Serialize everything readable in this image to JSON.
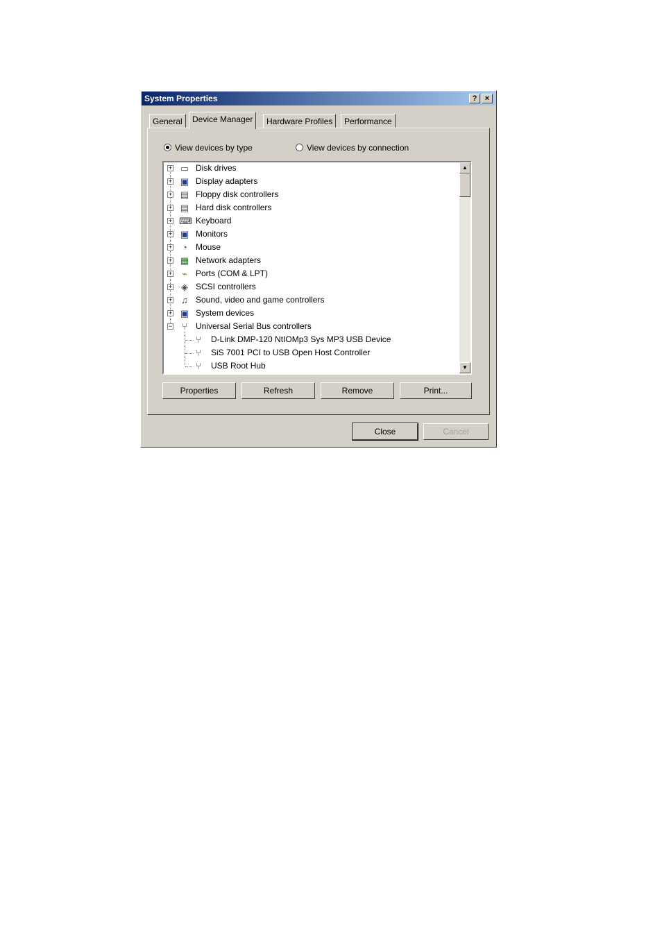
{
  "window": {
    "title": "System Properties",
    "help_btn": "?",
    "close_btn": "×"
  },
  "tabs": [
    {
      "label": "General"
    },
    {
      "label": "Device Manager",
      "active": true
    },
    {
      "label": "Hardware Profiles"
    },
    {
      "label": "Performance"
    }
  ],
  "view": {
    "by_type": "View devices by type",
    "by_connection": "View devices by connection",
    "selected": "by_type"
  },
  "tree": {
    "categories": [
      {
        "label": "Disk drives",
        "icon": "disk-drive-icon",
        "glyph": "▭",
        "expanded": false
      },
      {
        "label": "Display adapters",
        "icon": "display-adapter-icon",
        "glyph": "▣",
        "expanded": false
      },
      {
        "label": "Floppy disk controllers",
        "icon": "floppy-controller-icon",
        "glyph": "▤",
        "expanded": false
      },
      {
        "label": "Hard disk controllers",
        "icon": "hard-disk-controller-icon",
        "glyph": "▤",
        "expanded": false
      },
      {
        "label": "Keyboard",
        "icon": "keyboard-icon",
        "glyph": "⌨",
        "expanded": false
      },
      {
        "label": "Monitors",
        "icon": "monitor-icon",
        "glyph": "▣",
        "expanded": false
      },
      {
        "label": "Mouse",
        "icon": "mouse-icon",
        "glyph": "◔",
        "expanded": false
      },
      {
        "label": "Network adapters",
        "icon": "network-adapter-icon",
        "glyph": "▦",
        "expanded": false
      },
      {
        "label": "Ports (COM & LPT)",
        "icon": "port-icon",
        "glyph": "⌁",
        "expanded": false
      },
      {
        "label": "SCSI controllers",
        "icon": "scsi-icon",
        "glyph": "◈",
        "expanded": false
      },
      {
        "label": "Sound, video and game controllers",
        "icon": "sound-icon",
        "glyph": "♫",
        "expanded": false
      },
      {
        "label": "System devices",
        "icon": "system-device-icon",
        "glyph": "▣",
        "expanded": false
      },
      {
        "label": "Universal Serial Bus controllers",
        "icon": "usb-icon",
        "glyph": "⑂",
        "expanded": true
      }
    ],
    "usb_children": [
      {
        "label": "D-Link DMP-120 NtIOMp3 Sys MP3 USB Device",
        "icon": "usb-device-icon",
        "glyph": "⑂"
      },
      {
        "label": "SiS 7001 PCI to USB Open Host Controller",
        "icon": "usb-device-icon",
        "glyph": "⑂"
      },
      {
        "label": "USB Root Hub",
        "icon": "usb-device-icon",
        "glyph": "⑂"
      }
    ],
    "expander_plus": "+",
    "expander_minus": "−"
  },
  "scrollbar": {
    "up": "▲",
    "down": "▼"
  },
  "buttons": {
    "properties": "Properties",
    "refresh": "Refresh",
    "remove": "Remove",
    "print": "Print..."
  },
  "footer": {
    "close": "Close",
    "cancel": "Cancel"
  },
  "colors": {
    "titlebar_start": "#0a246a",
    "titlebar_end": "#a6caf0",
    "face": "#d4d0c8"
  }
}
